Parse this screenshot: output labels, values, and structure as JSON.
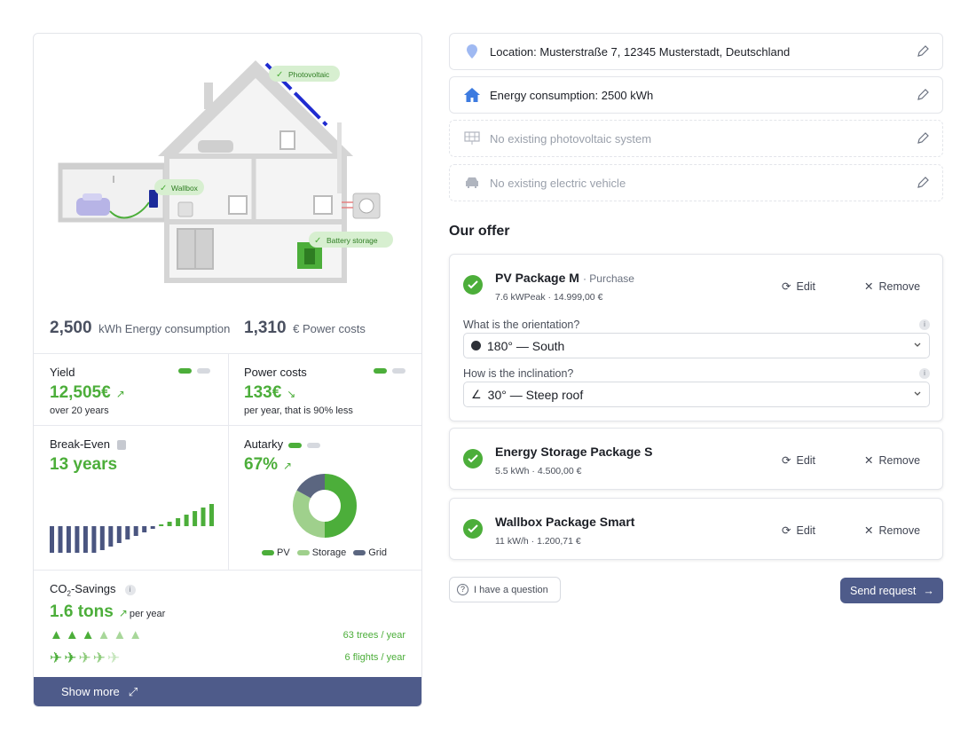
{
  "house": {
    "labels": {
      "photovoltaic": "Photovoltaic",
      "wallbox": "Wallbox",
      "battery": "Battery storage"
    }
  },
  "summary": {
    "consumption_value": "2,500",
    "consumption_label": "kWh Energy consumption",
    "costs_value": "1,310",
    "costs_label": "€ Power costs"
  },
  "tiles": {
    "yield": {
      "title": "Yield",
      "value": "12,505€",
      "sub": "over 20 years"
    },
    "power_costs": {
      "title": "Power costs",
      "value": "133€",
      "sub": "per year, that is 90% less"
    },
    "break_even": {
      "title": "Break-Even",
      "value": "13 years"
    },
    "autarky": {
      "title": "Autarky",
      "value": "67%",
      "legend": [
        "PV",
        "Storage",
        "Grid"
      ]
    },
    "co2": {
      "title_main": "CO",
      "title_sub": "2",
      "title_rest": "-Savings",
      "value": "1.6 tons",
      "per": "per year",
      "trees": "63 trees / year",
      "flights": "6 flights / year"
    }
  },
  "break_even_chart": {
    "values": [
      -10,
      -9.3,
      -8.5,
      -7.8,
      -7,
      -6.2,
      -5.4,
      -4.6,
      -3.8,
      -3,
      -2.2,
      -1.4,
      -0.6,
      0.2,
      1,
      1.8,
      2.6,
      3.4,
      4.2,
      5
    ],
    "colors": {
      "negative": "#4a5580",
      "positive": "#4cae3a"
    }
  },
  "autarky_chart": {
    "slices": [
      {
        "name": "PV",
        "value": 50,
        "color": "#4cae3a"
      },
      {
        "name": "Storage",
        "value": 33,
        "color": "#9fd08c"
      },
      {
        "name": "Grid",
        "value": 17,
        "color": "#5b6680"
      }
    ]
  },
  "co2_icons": {
    "trees_total": 6,
    "trees_filled": 3,
    "flights_total": 5,
    "flights_filled": 2
  },
  "left_footer": {
    "show_more": "Show more"
  },
  "fields": {
    "location": "Location: Musterstraße 7, 12345 Musterstadt, Deutschland",
    "consumption": "Energy consumption: 2500 kWh",
    "pv": "No existing photovoltaic system",
    "ev": "No existing electric vehicle"
  },
  "offer": {
    "title": "Our offer",
    "edit": "Edit",
    "remove": "Remove",
    "packages": [
      {
        "name": "PV Package M",
        "tag": "· Purchase",
        "meta": "7.6 kWPeak · 14.999,00 €",
        "q1": "What is the orientation?",
        "a1": "180° — South",
        "q2": "How is the inclination?",
        "a2": "30° — Steep roof"
      },
      {
        "name": "Energy Storage Package S",
        "meta": "5.5 kWh · 4.500,00 €"
      },
      {
        "name": "Wallbox Package Smart",
        "meta": "11 kW/h · 1.200,71 €"
      }
    ]
  },
  "footer": {
    "question": "I have a question",
    "send": "Send request"
  }
}
